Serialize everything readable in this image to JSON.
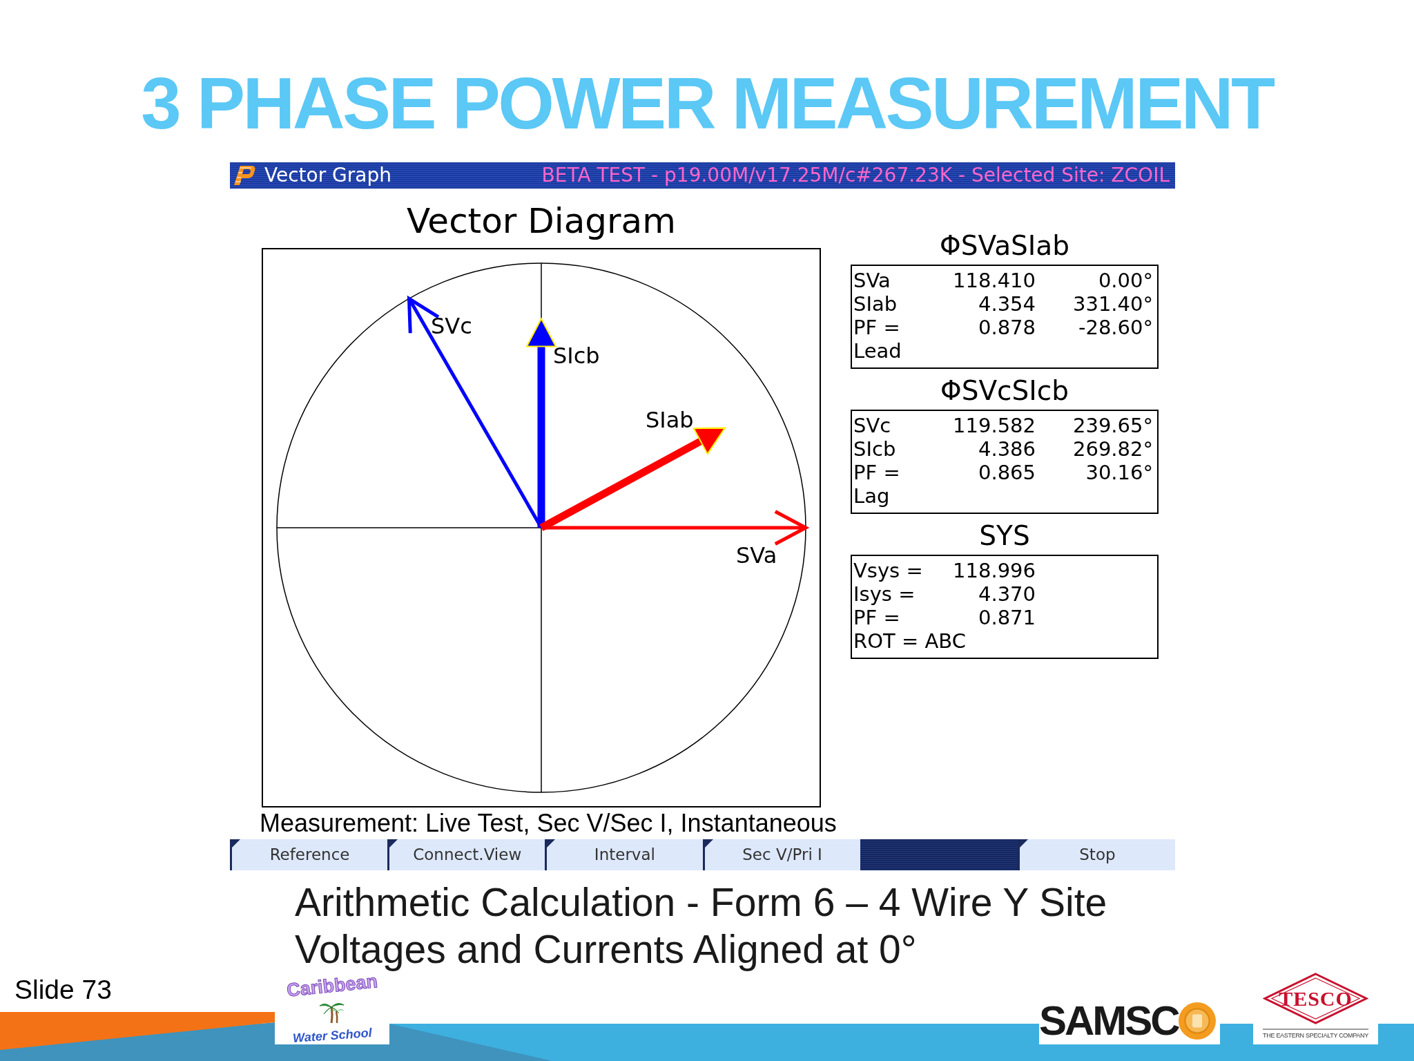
{
  "slide": {
    "title": "3 PHASE POWER MEASUREMENT",
    "slide_number": "Slide 73"
  },
  "window": {
    "title": "Vector Graph",
    "status": "BETA TEST - p19.00M/v17.25M/c#267.23K - Selected Site: ZCOIL"
  },
  "diagram": {
    "title": "Vector Diagram",
    "vectors": [
      {
        "label": "SVc",
        "kind": "voltage",
        "color": "#0000ff"
      },
      {
        "label": "SIcb",
        "kind": "current",
        "color": "#0000ff"
      },
      {
        "label": "SIab",
        "kind": "current",
        "color": "#ff0000"
      },
      {
        "label": "SVa",
        "kind": "voltage",
        "color": "#ff0000"
      }
    ]
  },
  "readouts": [
    {
      "title": "ΦSVaSIab",
      "rows": [
        [
          "SVa",
          "118.410",
          "0.00°"
        ],
        [
          "SIab",
          "4.354",
          "331.40°"
        ],
        [
          "PF =",
          "0.878",
          "-28.60°"
        ],
        [
          "Lead"
        ]
      ]
    },
    {
      "title": "ΦSVcSIcb",
      "rows": [
        [
          "SVc",
          "119.582",
          "239.65°"
        ],
        [
          "SIcb",
          "4.386",
          "269.82°"
        ],
        [
          "PF =",
          "0.865",
          "30.16°"
        ],
        [
          "Lag"
        ]
      ]
    },
    {
      "title": "SYS",
      "rows": [
        [
          "Vsys =",
          "118.996"
        ],
        [
          "Isys =",
          "4.370"
        ],
        [
          "PF =",
          "0.871"
        ],
        [
          "ROT = ABC"
        ]
      ]
    }
  ],
  "measurement": "Measurement: Live Test, Sec V/Sec I, Instantaneous",
  "softkeys": [
    {
      "kind": "key",
      "label": "Reference"
    },
    {
      "kind": "key",
      "label": "Connect.View"
    },
    {
      "kind": "key",
      "label": "Interval"
    },
    {
      "kind": "key",
      "label": "Sec V/Pri I"
    },
    {
      "kind": "blank"
    },
    {
      "kind": "key",
      "label": "Stop"
    }
  ],
  "caption": [
    "Arithmetic Calculation - Form 6 – 4 Wire Y Site",
    "Voltages and Currents Aligned at 0°"
  ],
  "logos": [
    {
      "kind": "school",
      "lines": [
        "Caribbean",
        "Water School"
      ]
    },
    {
      "kind": "wordmark",
      "text": "SAMSC"
    },
    {
      "kind": "emblem",
      "text": "TESCO",
      "tagline": "THE EASTERN SPECIALTY COMPANY"
    }
  ]
}
